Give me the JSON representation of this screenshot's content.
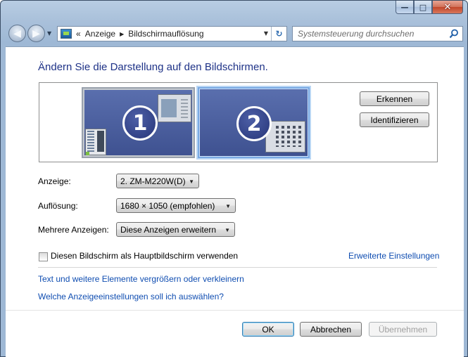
{
  "window": {
    "minimize_label": "—",
    "maximize_label": "□",
    "close_label": "✕"
  },
  "nav": {
    "back": "◀",
    "forward": "▶",
    "dropdown": "▼"
  },
  "address": {
    "prefix": "«",
    "crumbs": [
      "Anzeige",
      "Bildschirmauflösung"
    ],
    "separator": "▶",
    "dropdown": "▼",
    "refresh": "↻"
  },
  "search": {
    "placeholder": "Systemsteuerung durchsuchen"
  },
  "page": {
    "title": "Ändern Sie die Darstellung auf den Bildschirmen."
  },
  "preview": {
    "monitors": [
      {
        "number": "1",
        "selected": false
      },
      {
        "number": "2",
        "selected": true
      }
    ],
    "detect_button": "Erkennen",
    "identify_button": "Identifizieren"
  },
  "settings": {
    "display_label": "Anzeige:",
    "display_value": "2. ZM-M220W(D)",
    "resolution_label": "Auflösung:",
    "resolution_value": "1680 × 1050 (empfohlen)",
    "multi_label": "Mehrere Anzeigen:",
    "multi_value": "Diese Anzeigen erweitern",
    "combo_arrow": "▼"
  },
  "primary": {
    "checkbox_label": "Diesen Bildschirm als Hauptbildschirm verwenden",
    "checked": false
  },
  "links": {
    "advanced": "Erweiterte Einstellungen",
    "text_size": "Text und weitere Elemente vergrößern oder verkleinern",
    "which_settings": "Welche Anzeigeeinstellungen soll ich auswählen?"
  },
  "buttons": {
    "ok": "OK",
    "cancel": "Abbrechen",
    "apply": "Übernehmen"
  },
  "colors": {
    "title": "#1e3287",
    "link": "#0f4db1",
    "monitor": "#3e5190"
  }
}
